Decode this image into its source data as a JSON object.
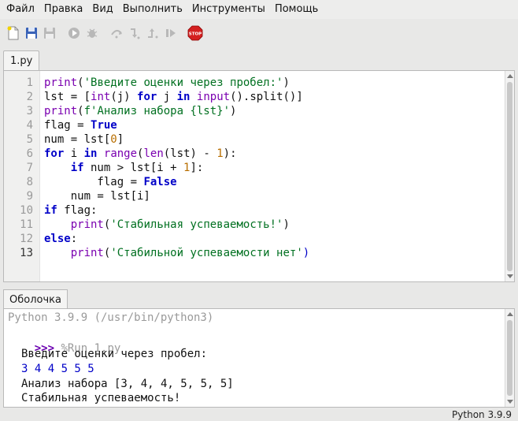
{
  "menu": {
    "items": [
      "Файл",
      "Правка",
      "Вид",
      "Выполнить",
      "Инструменты",
      "Помощь"
    ]
  },
  "toolbar": {
    "icons": [
      "new-file-icon",
      "open-file-icon",
      "save-file-icon",
      "run-icon",
      "debug-icon",
      "step-over-icon",
      "step-into-icon",
      "step-out-icon",
      "resume-icon",
      "stop-icon"
    ],
    "stop_label": "STOP"
  },
  "editor": {
    "tab_label": "1.py",
    "lines": [
      {
        "num": "1",
        "tokens": [
          {
            "t": "b",
            "v": "print"
          },
          {
            "t": "p",
            "v": "("
          },
          {
            "t": "s",
            "v": "'Введите оценки через пробел:'"
          },
          {
            "t": "p",
            "v": ")"
          }
        ]
      },
      {
        "num": "2",
        "tokens": [
          {
            "t": "p",
            "v": "lst = ["
          },
          {
            "t": "b",
            "v": "int"
          },
          {
            "t": "p",
            "v": "(j) "
          },
          {
            "t": "k",
            "v": "for"
          },
          {
            "t": "p",
            "v": " j "
          },
          {
            "t": "k",
            "v": "in"
          },
          {
            "t": "p",
            "v": " "
          },
          {
            "t": "b",
            "v": "input"
          },
          {
            "t": "p",
            "v": "().split()]"
          }
        ]
      },
      {
        "num": "3",
        "tokens": [
          {
            "t": "b",
            "v": "print"
          },
          {
            "t": "p",
            "v": "("
          },
          {
            "t": "s",
            "v": "f'Анализ набора {lst}'"
          },
          {
            "t": "p",
            "v": ")"
          }
        ]
      },
      {
        "num": "4",
        "tokens": [
          {
            "t": "p",
            "v": "flag = "
          },
          {
            "t": "k",
            "v": "True"
          }
        ]
      },
      {
        "num": "5",
        "tokens": [
          {
            "t": "p",
            "v": "num = lst["
          },
          {
            "t": "n",
            "v": "0"
          },
          {
            "t": "p",
            "v": "]"
          }
        ]
      },
      {
        "num": "6",
        "tokens": [
          {
            "t": "k",
            "v": "for"
          },
          {
            "t": "p",
            "v": " i "
          },
          {
            "t": "k",
            "v": "in"
          },
          {
            "t": "p",
            "v": " "
          },
          {
            "t": "b",
            "v": "range"
          },
          {
            "t": "p",
            "v": "("
          },
          {
            "t": "b",
            "v": "len"
          },
          {
            "t": "p",
            "v": "(lst) - "
          },
          {
            "t": "n",
            "v": "1"
          },
          {
            "t": "p",
            "v": "):"
          }
        ]
      },
      {
        "num": "7",
        "tokens": [
          {
            "t": "p",
            "v": "    "
          },
          {
            "t": "k",
            "v": "if"
          },
          {
            "t": "p",
            "v": " num > lst[i + "
          },
          {
            "t": "n",
            "v": "1"
          },
          {
            "t": "p",
            "v": "]:"
          }
        ]
      },
      {
        "num": "8",
        "tokens": [
          {
            "t": "p",
            "v": "        flag = "
          },
          {
            "t": "k",
            "v": "False"
          }
        ]
      },
      {
        "num": "9",
        "tokens": [
          {
            "t": "p",
            "v": "    num = lst[i]"
          }
        ]
      },
      {
        "num": "10",
        "tokens": [
          {
            "t": "k",
            "v": "if"
          },
          {
            "t": "p",
            "v": " flag:"
          }
        ]
      },
      {
        "num": "11",
        "tokens": [
          {
            "t": "p",
            "v": "    "
          },
          {
            "t": "b",
            "v": "print"
          },
          {
            "t": "p",
            "v": "("
          },
          {
            "t": "s",
            "v": "'Стабильная успеваемость!'"
          },
          {
            "t": "p",
            "v": ")"
          }
        ]
      },
      {
        "num": "12",
        "tokens": [
          {
            "t": "k",
            "v": "else"
          },
          {
            "t": "p",
            "v": ":"
          }
        ]
      },
      {
        "num": "13",
        "tokens": [
          {
            "t": "p",
            "v": "    "
          },
          {
            "t": "b",
            "v": "print"
          },
          {
            "t": "p",
            "v": "("
          },
          {
            "t": "s",
            "v": "'Стабильной успеваемости нет'"
          },
          {
            "t": "bm",
            "v": ")"
          }
        ]
      }
    ]
  },
  "shell": {
    "tab_label": "Оболочка",
    "banner": "Python 3.9.9 (/usr/bin/python3)",
    "prompt": ">>>",
    "run_command": "%Run 1.py",
    "output_1": "Введите оценки через пробел:",
    "user_input": "3 4 4 5 5 5",
    "output_2": "Анализ набора [3, 4, 4, 5, 5, 5]",
    "output_3": "Стабильная успеваемость!"
  },
  "status": {
    "interpreter": "Python 3.9.9"
  },
  "colors": {
    "keyword": "#0000c8",
    "builtin": "#7a00b0",
    "string": "#007020",
    "number": "#b86e00",
    "prompt": "#6a00b0",
    "stop": "#d42020"
  }
}
